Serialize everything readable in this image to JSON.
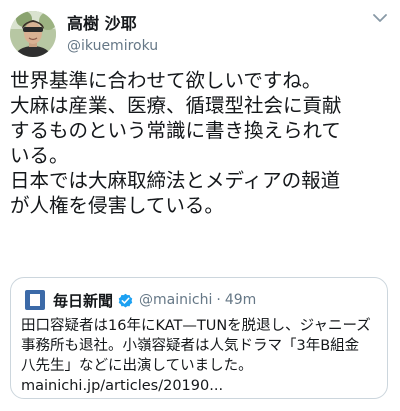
{
  "author": {
    "display_name": "高樹 沙耶",
    "handle": "@ikuemiroku"
  },
  "tweet": {
    "lines": [
      "世界基準に合わせて欲しいですね。",
      "大麻は産業、医療、循環型社会に貢献",
      "するものという常識に書き換えられて",
      "いる。",
      "日本では大麻取締法とメディアの報道",
      "が人権を侵害している。"
    ]
  },
  "quoted_tweet": {
    "name": "毎日新聞",
    "handle": "@mainichi",
    "separator": "·",
    "time": "49m",
    "lines": [
      "田口容疑者は16年にKAT—TUNを脱退し、ジャニーズ",
      "事務所も退社。小嶺容疑者は人気ドラマ「3年B組金",
      "八先生」などに出演していました。",
      "mainichi.jp/articles/20190..."
    ]
  },
  "icons": {
    "caret": "chevron-down-icon",
    "verified": "verified-badge-icon",
    "logo": "mainichi-logo-icon"
  },
  "colors": {
    "verified": "#1da1f2",
    "secondary_text": "#657786",
    "card_border": "#ccd6dd"
  }
}
